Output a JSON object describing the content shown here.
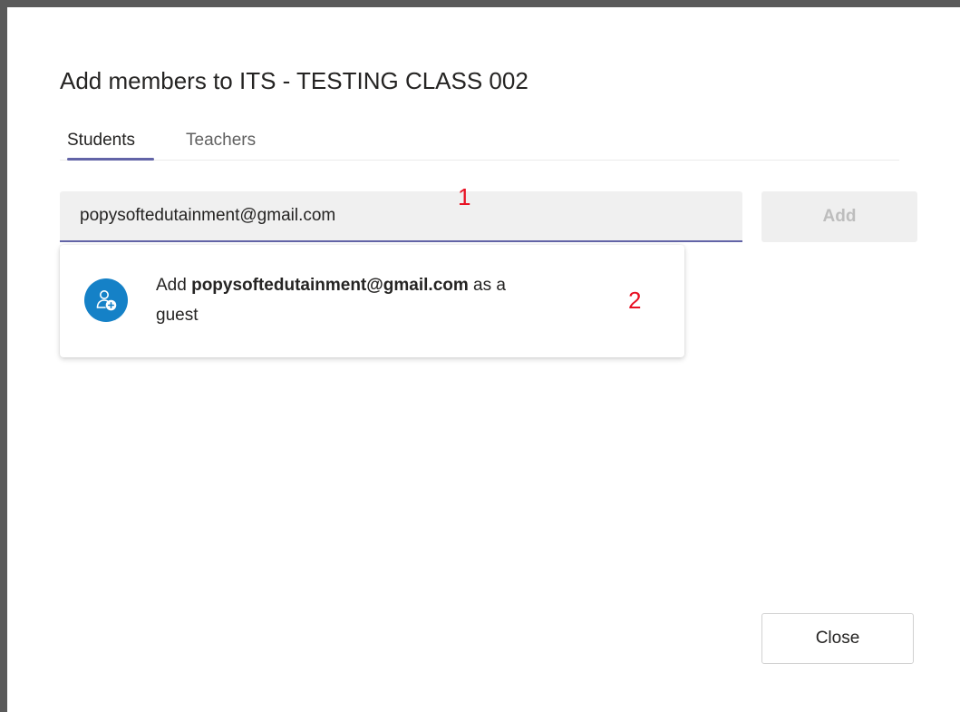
{
  "dialog": {
    "title": "Add members to ITS - TESTING CLASS 002"
  },
  "tabs": [
    {
      "label": "Students",
      "active": true
    },
    {
      "label": "Teachers",
      "active": false
    }
  ],
  "search": {
    "value": "popysoftedutainment@gmail.com",
    "placeholder": ""
  },
  "add_button": {
    "label": "Add",
    "enabled": false
  },
  "suggestion": {
    "prefix": "Add ",
    "email": "popysoftedutainment@gmail.com",
    "suffix_line1": " as a",
    "suffix_line2": "guest",
    "icon": "add-guest-icon"
  },
  "annotations": {
    "one": "1",
    "two": "2"
  },
  "close_button": {
    "label": "Close"
  },
  "colors": {
    "accent": "#6264a7",
    "avatar": "#1581c7",
    "annotation": "#e81123"
  }
}
